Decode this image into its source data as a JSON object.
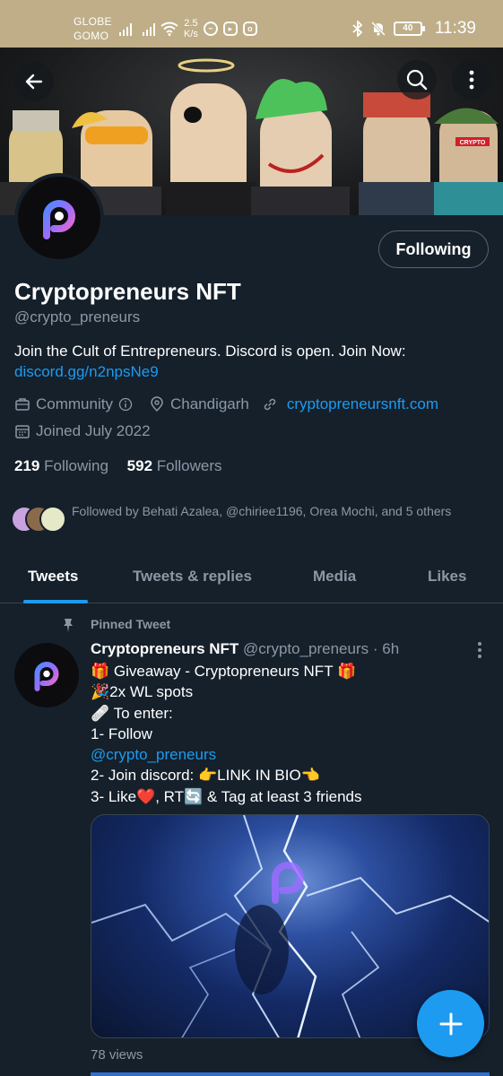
{
  "status_bar": {
    "carrier_line1": "GLOBE",
    "carrier_line2": "GOMO",
    "speed_value": "2.5",
    "speed_unit": "K/s",
    "battery": "40",
    "time": "11:39"
  },
  "profile": {
    "name": "Cryptopreneurs NFT",
    "handle": "@crypto_preneurs",
    "follow_button": "Following",
    "bio_text": "Join the Cult of Entrepreneurs. Discord is open. Join Now:",
    "bio_link": "discord.gg/n2npsNe9",
    "category": "Community",
    "location": "Chandigarh",
    "website": "cryptopreneursnft.com",
    "joined": "Joined July 2022",
    "following_count": "219",
    "following_label": "Following",
    "followers_count": "592",
    "followers_label": "Followers",
    "followed_by": "Followed by Behati Azalea, @chiriee1196, Orea Mochi, and 5 others"
  },
  "banner": {
    "badge_text": "CRYPTO"
  },
  "tabs": [
    {
      "label": "Tweets",
      "active": true
    },
    {
      "label": "Tweets & replies",
      "active": false
    },
    {
      "label": "Media",
      "active": false
    },
    {
      "label": "Likes",
      "active": false
    }
  ],
  "tweet": {
    "pinned_label": "Pinned Tweet",
    "author": "Cryptopreneurs NFT",
    "handle": "@crypto_preneurs",
    "separator": "·",
    "time": "6h",
    "lines": [
      "🎁 Giveaway - Cryptopreneurs NFT  🎁",
      "🎉2x WL spots",
      "🩹 To enter:",
      "1- Follow",
      "@crypto_preneurs",
      "2- Join discord: 👉LINK IN BIO👈",
      "3- Like❤️, RT🔄 & Tag at least 3 friends"
    ],
    "views": "78 views"
  },
  "colors": {
    "background": "#15202b",
    "accent": "#1d9bf0",
    "muted_text": "#8b98a5",
    "status_bar": "#bfae88"
  },
  "icons": [
    "back-arrow-icon",
    "search-icon",
    "more-vertical-icon",
    "briefcase-icon",
    "info-icon",
    "location-pin-icon",
    "link-icon",
    "calendar-icon",
    "pin-icon",
    "plus-icon"
  ]
}
